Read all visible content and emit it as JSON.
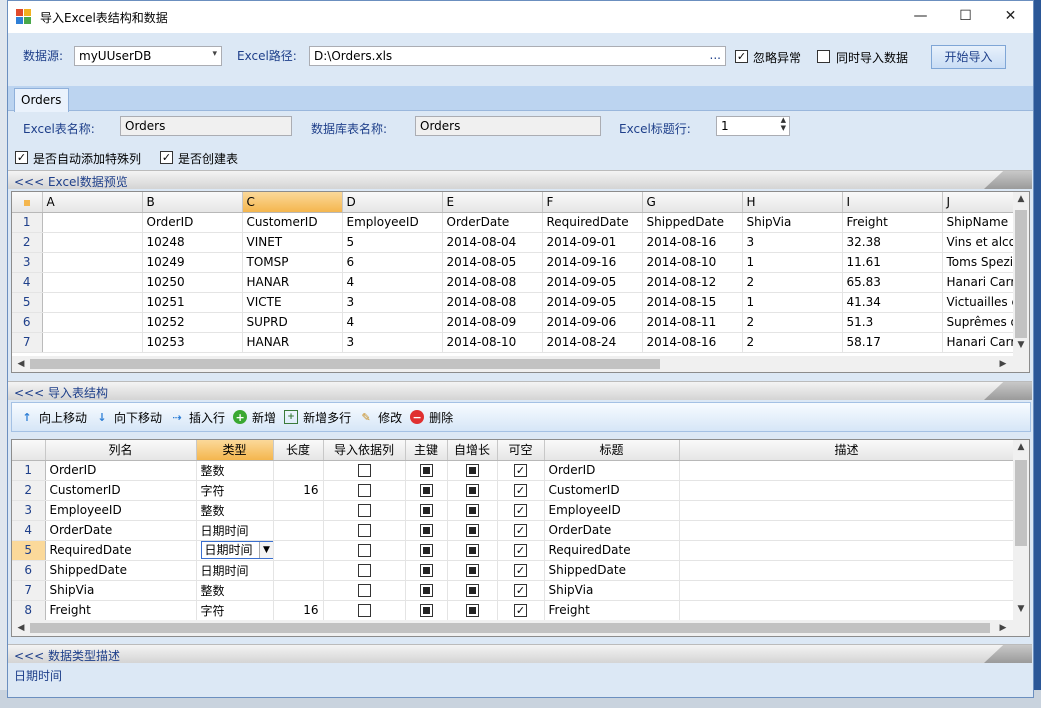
{
  "window": {
    "title": "导入Excel表结构和数据",
    "minimize": "—",
    "maximize": "☐",
    "close": "✕"
  },
  "top": {
    "datasource_label": "数据源:",
    "datasource_value": "myUUserDB",
    "excel_path_label": "Excel路径:",
    "excel_path_value": "D:\\Orders.xls",
    "browse": "...",
    "ignore_errors_label": "忽略异常",
    "ignore_errors_checked": true,
    "import_data_label": "同时导入数据",
    "import_data_checked": false,
    "start_button": "开始导入"
  },
  "tabs": [
    {
      "label": "Orders"
    }
  ],
  "sheet": {
    "excel_name_label": "Excel表名称:",
    "excel_name_value": "Orders",
    "db_name_label": "数据库表名称:",
    "db_name_value": "Orders",
    "title_row_label": "Excel标题行:",
    "title_row_value": "1",
    "auto_add_label": "是否自动添加特殊列",
    "auto_add_checked": true,
    "create_table_label": "是否创建表",
    "create_table_checked": true
  },
  "preview": {
    "section_title": "<<< Excel数据预览",
    "columns": [
      "A",
      "B",
      "C",
      "D",
      "E",
      "F",
      "G",
      "H",
      "I",
      "J"
    ],
    "rows": [
      [
        "1",
        "",
        "OrderID",
        "CustomerID",
        "EmployeeID",
        "OrderDate",
        "RequiredDate",
        "ShippedDate",
        "ShipVia",
        "Freight",
        "ShipName"
      ],
      [
        "2",
        "",
        "10248",
        "VINET",
        "5",
        "2014-08-04",
        "2014-09-01",
        "2014-08-16",
        "3",
        "32.38",
        "Vins et alco"
      ],
      [
        "3",
        "",
        "10249",
        "TOMSP",
        "6",
        "2014-08-05",
        "2014-09-16",
        "2014-08-10",
        "1",
        "11.61",
        "Toms Spezi"
      ],
      [
        "4",
        "",
        "10250",
        "HANAR",
        "4",
        "2014-08-08",
        "2014-09-05",
        "2014-08-12",
        "2",
        "65.83",
        "Hanari Carr"
      ],
      [
        "5",
        "",
        "10251",
        "VICTE",
        "3",
        "2014-08-08",
        "2014-09-05",
        "2014-08-15",
        "1",
        "41.34",
        "Victuailles e"
      ],
      [
        "6",
        "",
        "10252",
        "SUPRD",
        "4",
        "2014-08-09",
        "2014-09-06",
        "2014-08-11",
        "2",
        "51.3",
        "Suprêmes d"
      ],
      [
        "7",
        "",
        "10253",
        "HANAR",
        "3",
        "2014-08-10",
        "2014-08-24",
        "2014-08-16",
        "2",
        "58.17",
        "Hanari Carr"
      ]
    ]
  },
  "structure": {
    "section_title": "<<< 导入表结构",
    "toolbar": {
      "move_up": "向上移动",
      "move_down": "向下移动",
      "insert_row": "插入行",
      "add": "新增",
      "add_multi": "新增多行",
      "edit": "修改",
      "delete": "删除"
    },
    "columns": [
      "列名",
      "类型",
      "长度",
      "导入依据列",
      "主键",
      "自增长",
      "可空",
      "标题",
      "描述"
    ],
    "rows": [
      {
        "n": "1",
        "name": "OrderID",
        "type": "整数",
        "len": "",
        "pk": true,
        "auto": true,
        "nullable": true,
        "title": "OrderID"
      },
      {
        "n": "2",
        "name": "CustomerID",
        "type": "字符",
        "len": "16",
        "pk": true,
        "auto": true,
        "nullable": true,
        "title": "CustomerID"
      },
      {
        "n": "3",
        "name": "EmployeeID",
        "type": "整数",
        "len": "",
        "pk": true,
        "auto": true,
        "nullable": true,
        "title": "EmployeeID"
      },
      {
        "n": "4",
        "name": "OrderDate",
        "type": "日期时间",
        "len": "",
        "pk": true,
        "auto": true,
        "nullable": true,
        "title": "OrderDate"
      },
      {
        "n": "5",
        "name": "RequiredDate",
        "type": "日期时间",
        "len": "",
        "pk": true,
        "auto": true,
        "nullable": true,
        "title": "RequiredDate"
      },
      {
        "n": "6",
        "name": "ShippedDate",
        "type": "日期时间",
        "len": "",
        "pk": true,
        "auto": true,
        "nullable": true,
        "title": "ShippedDate"
      },
      {
        "n": "7",
        "name": "ShipVia",
        "type": "整数",
        "len": "",
        "pk": true,
        "auto": true,
        "nullable": true,
        "title": "ShipVia"
      },
      {
        "n": "8",
        "name": "Freight",
        "type": "字符",
        "len": "16",
        "pk": true,
        "auto": true,
        "nullable": true,
        "title": "Freight"
      }
    ]
  },
  "type_desc": {
    "section_title": "<<< 数据类型描述",
    "value": "日期时间"
  }
}
